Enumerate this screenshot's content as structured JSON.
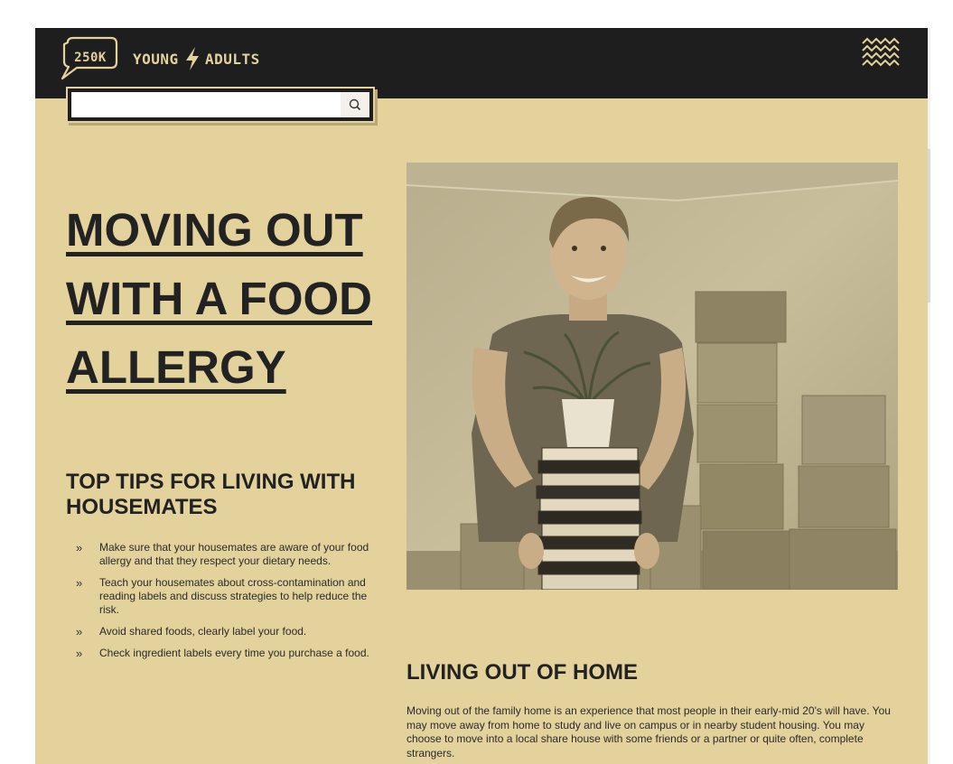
{
  "header": {
    "logo_badge": "250K",
    "logo_word_1": "YOUNG",
    "logo_word_2": "ADULTS",
    "menu_icon": "wavy-lines-menu-icon",
    "bolt_icon": "lightning-bolt-icon"
  },
  "search": {
    "placeholder": "",
    "value": "",
    "button_icon": "search-icon"
  },
  "article": {
    "title_lines": [
      "MOVING OUT",
      "WITH A FOOD",
      "ALLERGY"
    ],
    "tips_heading": "TOP TIPS FOR LIVING WITH HOUSEMATES",
    "tips": [
      "Make sure that your housemates are aware of your food allergy and that they respect your dietary needs.",
      "Teach your housemates about cross-contamination and reading labels and discuss strategies to help reduce the risk.",
      "Avoid shared foods, clearly label your food.",
      "Check ingredient labels every time you purchase a food."
    ],
    "bullet_glyph": "»",
    "section_heading": "LIVING OUT OF HOME",
    "section_body": "Moving out of the family home is an experience that most people in their early-mid 20's will have. You may move away from home to study and live on campus or in nearby student housing. You may choose to move into a local share house with some friends or a partner or quite often, complete strangers."
  },
  "colors": {
    "background": "#e3d29c",
    "header": "#1e1e1e",
    "text": "#222222"
  }
}
